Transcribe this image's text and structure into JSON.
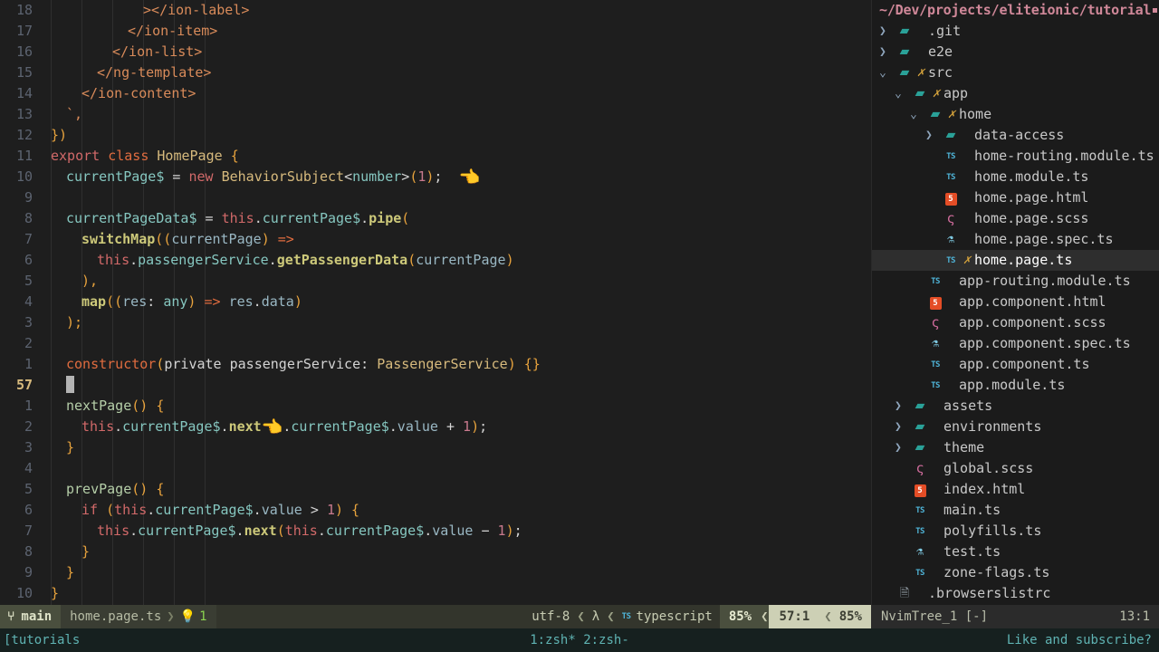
{
  "app": {
    "kind": "neovim-terminal",
    "accent_amber": "#d7ba7d",
    "accent_green": "#8bd450",
    "accent_teal": "#5fb3b3",
    "editor_bg": "#1e1e1e",
    "tree_bg": "#1b1b1b"
  },
  "editor": {
    "lines": [
      {
        "num": "18",
        "current": false,
        "indent": 6,
        "segs": [
          {
            "t": "><",
            "c": "tag"
          },
          {
            "t": "/ion-label>",
            "c": "tag"
          }
        ]
      },
      {
        "num": "17",
        "current": false,
        "indent": 5,
        "segs": [
          {
            "t": "</ion-item>",
            "c": "tag"
          }
        ]
      },
      {
        "num": "16",
        "current": false,
        "indent": 4,
        "segs": [
          {
            "t": "</ion-list>",
            "c": "tag"
          }
        ]
      },
      {
        "num": "15",
        "current": false,
        "indent": 3,
        "segs": [
          {
            "t": "</ng-template>",
            "c": "tag"
          }
        ]
      },
      {
        "num": "14",
        "current": false,
        "indent": 2,
        "segs": [
          {
            "t": "</ion-content>",
            "c": "tag"
          }
        ]
      },
      {
        "num": "13",
        "current": false,
        "indent": 1,
        "segs": [
          {
            "t": "`,",
            "c": "strq"
          }
        ]
      },
      {
        "num": "12",
        "current": false,
        "indent": 0,
        "segs": [
          {
            "t": "})",
            "c": "punct"
          }
        ]
      },
      {
        "num": "11",
        "current": false,
        "indent": 0,
        "segs": [
          {
            "t": "export",
            "c": "kw2"
          },
          {
            "t": " ",
            "c": "plain"
          },
          {
            "t": "class",
            "c": "kw"
          },
          {
            "t": " ",
            "c": "plain"
          },
          {
            "t": "HomePage",
            "c": "type"
          },
          {
            "t": " ",
            "c": "plain"
          },
          {
            "t": "{",
            "c": "punct"
          }
        ]
      },
      {
        "num": "10",
        "current": false,
        "indent": 1,
        "segs": [
          {
            "t": "currentPage$",
            "c": "cyan"
          },
          {
            "t": " ",
            "c": "plain"
          },
          {
            "t": "=",
            "c": "plain"
          },
          {
            "t": " ",
            "c": "plain"
          },
          {
            "t": "new",
            "c": "kw2"
          },
          {
            "t": " ",
            "c": "plain"
          },
          {
            "t": "BehaviorSubject",
            "c": "type"
          },
          {
            "t": "<",
            "c": "plain"
          },
          {
            "t": "number",
            "c": "cyan"
          },
          {
            "t": ">",
            "c": "plain"
          },
          {
            "t": "(",
            "c": "punct"
          },
          {
            "t": "1",
            "c": "num"
          },
          {
            "t": ")",
            "c": "punct"
          },
          {
            "t": ";",
            "c": "plain"
          },
          {
            "t": "  ",
            "c": "plain"
          },
          {
            "t": "👈",
            "c": "emoji"
          }
        ]
      },
      {
        "num": "9",
        "current": false,
        "indent": 1,
        "segs": []
      },
      {
        "num": "8",
        "current": false,
        "indent": 1,
        "segs": [
          {
            "t": "currentPageData$",
            "c": "cyan"
          },
          {
            "t": " = ",
            "c": "plain"
          },
          {
            "t": "this",
            "c": "bobj"
          },
          {
            "t": ".",
            "c": "plain"
          },
          {
            "t": "currentPage$",
            "c": "cyan"
          },
          {
            "t": ".",
            "c": "plain"
          },
          {
            "t": "pipe",
            "c": "fnbold"
          },
          {
            "t": "(",
            "c": "punct"
          }
        ]
      },
      {
        "num": "7",
        "current": false,
        "indent": 2,
        "segs": [
          {
            "t": "switchMap",
            "c": "fnbold"
          },
          {
            "t": "((",
            "c": "punct"
          },
          {
            "t": "currentPage",
            "c": "prop"
          },
          {
            "t": ")",
            "c": "punct"
          },
          {
            "t": " ",
            "c": "plain"
          },
          {
            "t": "=>",
            "c": "op"
          }
        ]
      },
      {
        "num": "6",
        "current": false,
        "indent": 3,
        "segs": [
          {
            "t": "this",
            "c": "bobj"
          },
          {
            "t": ".",
            "c": "plain"
          },
          {
            "t": "passengerService",
            "c": "cyan"
          },
          {
            "t": ".",
            "c": "plain"
          },
          {
            "t": "getPassengerData",
            "c": "fnbold"
          },
          {
            "t": "(",
            "c": "punct"
          },
          {
            "t": "currentPage",
            "c": "prop"
          },
          {
            "t": ")",
            "c": "punct"
          }
        ]
      },
      {
        "num": "5",
        "current": false,
        "indent": 2,
        "segs": [
          {
            "t": "),",
            "c": "punct"
          }
        ]
      },
      {
        "num": "4",
        "current": false,
        "indent": 2,
        "segs": [
          {
            "t": "map",
            "c": "fnbold"
          },
          {
            "t": "((",
            "c": "punct"
          },
          {
            "t": "res",
            "c": "prop"
          },
          {
            "t": ": ",
            "c": "plain"
          },
          {
            "t": "any",
            "c": "cyan"
          },
          {
            "t": ")",
            "c": "punct"
          },
          {
            "t": " ",
            "c": "plain"
          },
          {
            "t": "=>",
            "c": "op"
          },
          {
            "t": " ",
            "c": "plain"
          },
          {
            "t": "res",
            "c": "prop"
          },
          {
            "t": ".",
            "c": "plain"
          },
          {
            "t": "data",
            "c": "prop"
          },
          {
            "t": ")",
            "c": "punct"
          }
        ]
      },
      {
        "num": "3",
        "current": false,
        "indent": 1,
        "segs": [
          {
            "t": ");",
            "c": "punct"
          }
        ]
      },
      {
        "num": "2",
        "current": false,
        "indent": 1,
        "segs": []
      },
      {
        "num": "1",
        "current": false,
        "indent": 1,
        "segs": [
          {
            "t": "constructor",
            "c": "kw"
          },
          {
            "t": "(",
            "c": "punct"
          },
          {
            "t": "private",
            "c": "plain"
          },
          {
            "t": " ",
            "c": "plain"
          },
          {
            "t": "passengerService",
            "c": "plain"
          },
          {
            "t": ": ",
            "c": "plain"
          },
          {
            "t": "PassengerService",
            "c": "type"
          },
          {
            "t": ")",
            "c": "punct"
          },
          {
            "t": " ",
            "c": "plain"
          },
          {
            "t": "{}",
            "c": "punct"
          }
        ]
      },
      {
        "num": "57",
        "current": true,
        "indent": 1,
        "cursor": true,
        "segs": []
      },
      {
        "num": "1",
        "current": false,
        "indent": 1,
        "segs": [
          {
            "t": "nextPage",
            "c": "fn"
          },
          {
            "t": "()",
            "c": "punct"
          },
          {
            "t": " ",
            "c": "plain"
          },
          {
            "t": "{",
            "c": "punct"
          }
        ]
      },
      {
        "num": "2",
        "current": false,
        "indent": 2,
        "segs": [
          {
            "t": "this",
            "c": "bobj"
          },
          {
            "t": ".",
            "c": "plain"
          },
          {
            "t": "currentPage$",
            "c": "cyan"
          },
          {
            "t": ".",
            "c": "plain"
          },
          {
            "t": "next",
            "c": "fnbold"
          },
          {
            "t": "👈",
            "c": "emoji"
          },
          {
            "t": ".",
            "c": "plain"
          },
          {
            "t": "currentPage$",
            "c": "cyan"
          },
          {
            "t": ".",
            "c": "plain"
          },
          {
            "t": "value",
            "c": "prop"
          },
          {
            "t": " + ",
            "c": "plain"
          },
          {
            "t": "1",
            "c": "num"
          },
          {
            "t": ")",
            "c": "punct"
          },
          {
            "t": ";",
            "c": "plain"
          }
        ]
      },
      {
        "num": "3",
        "current": false,
        "indent": 1,
        "segs": [
          {
            "t": "}",
            "c": "punct"
          }
        ]
      },
      {
        "num": "4",
        "current": false,
        "indent": 1,
        "segs": []
      },
      {
        "num": "5",
        "current": false,
        "indent": 1,
        "segs": [
          {
            "t": "prevPage",
            "c": "fn"
          },
          {
            "t": "()",
            "c": "punct"
          },
          {
            "t": " ",
            "c": "plain"
          },
          {
            "t": "{",
            "c": "punct"
          }
        ]
      },
      {
        "num": "6",
        "current": false,
        "indent": 2,
        "segs": [
          {
            "t": "if",
            "c": "kw2"
          },
          {
            "t": " ",
            "c": "plain"
          },
          {
            "t": "(",
            "c": "punct"
          },
          {
            "t": "this",
            "c": "bobj"
          },
          {
            "t": ".",
            "c": "plain"
          },
          {
            "t": "currentPage$",
            "c": "cyan"
          },
          {
            "t": ".",
            "c": "plain"
          },
          {
            "t": "value",
            "c": "prop"
          },
          {
            "t": " > ",
            "c": "plain"
          },
          {
            "t": "1",
            "c": "num"
          },
          {
            "t": ")",
            "c": "punct"
          },
          {
            "t": " ",
            "c": "plain"
          },
          {
            "t": "{",
            "c": "punct"
          }
        ]
      },
      {
        "num": "7",
        "current": false,
        "indent": 3,
        "segs": [
          {
            "t": "this",
            "c": "bobj"
          },
          {
            "t": ".",
            "c": "plain"
          },
          {
            "t": "currentPage$",
            "c": "cyan"
          },
          {
            "t": ".",
            "c": "plain"
          },
          {
            "t": "next",
            "c": "fnbold"
          },
          {
            "t": "(",
            "c": "punct"
          },
          {
            "t": "this",
            "c": "bobj"
          },
          {
            "t": ".",
            "c": "plain"
          },
          {
            "t": "currentPage$",
            "c": "cyan"
          },
          {
            "t": ".",
            "c": "plain"
          },
          {
            "t": "value",
            "c": "prop"
          },
          {
            "t": " − ",
            "c": "plain"
          },
          {
            "t": "1",
            "c": "num"
          },
          {
            "t": ")",
            "c": "punct"
          },
          {
            "t": ";",
            "c": "plain"
          }
        ]
      },
      {
        "num": "8",
        "current": false,
        "indent": 2,
        "segs": [
          {
            "t": "}",
            "c": "punct"
          }
        ]
      },
      {
        "num": "9",
        "current": false,
        "indent": 1,
        "segs": [
          {
            "t": "}",
            "c": "punct"
          }
        ]
      },
      {
        "num": "10",
        "current": false,
        "indent": 0,
        "segs": [
          {
            "t": "}",
            "c": "punct"
          }
        ]
      }
    ]
  },
  "tree": {
    "title": "~/Dev/projects/eliteionic/tutorial",
    "rows": [
      {
        "depth": 0,
        "arrow": "closed",
        "icon": "folder",
        "git": "",
        "label": ".git",
        "selected": false,
        "type": "dir"
      },
      {
        "depth": 0,
        "arrow": "closed",
        "icon": "folder",
        "git": "",
        "label": "e2e",
        "selected": false,
        "type": "dir"
      },
      {
        "depth": 0,
        "arrow": "open",
        "icon": "folder-open",
        "git": "✗",
        "label": "src",
        "selected": false,
        "type": "dir"
      },
      {
        "depth": 1,
        "arrow": "open",
        "icon": "folder-open",
        "git": "✗",
        "label": "app",
        "selected": false,
        "type": "dir"
      },
      {
        "depth": 2,
        "arrow": "open",
        "icon": "folder-open",
        "git": "✗",
        "label": "home",
        "selected": false,
        "type": "dir"
      },
      {
        "depth": 3,
        "arrow": "closed",
        "icon": "folder",
        "git": "",
        "label": "data-access",
        "selected": false,
        "type": "dir"
      },
      {
        "depth": 3,
        "arrow": "none",
        "icon": "ts",
        "git": "",
        "label": "home-routing.module.ts",
        "selected": false,
        "type": "file"
      },
      {
        "depth": 3,
        "arrow": "none",
        "icon": "ts",
        "git": "",
        "label": "home.module.ts",
        "selected": false,
        "type": "file"
      },
      {
        "depth": 3,
        "arrow": "none",
        "icon": "html",
        "git": "",
        "label": "home.page.html",
        "selected": false,
        "type": "file"
      },
      {
        "depth": 3,
        "arrow": "none",
        "icon": "scss",
        "git": "",
        "label": "home.page.scss",
        "selected": false,
        "type": "file"
      },
      {
        "depth": 3,
        "arrow": "none",
        "icon": "spec",
        "git": "",
        "label": "home.page.spec.ts",
        "selected": false,
        "type": "file"
      },
      {
        "depth": 3,
        "arrow": "none",
        "icon": "ts",
        "git": "✗",
        "label": "home.page.ts",
        "selected": true,
        "type": "file"
      },
      {
        "depth": 2,
        "arrow": "none",
        "icon": "ts",
        "git": "",
        "label": "app-routing.module.ts",
        "selected": false,
        "type": "file"
      },
      {
        "depth": 2,
        "arrow": "none",
        "icon": "html",
        "git": "",
        "label": "app.component.html",
        "selected": false,
        "type": "file"
      },
      {
        "depth": 2,
        "arrow": "none",
        "icon": "scss",
        "git": "",
        "label": "app.component.scss",
        "selected": false,
        "type": "file"
      },
      {
        "depth": 2,
        "arrow": "none",
        "icon": "spec",
        "git": "",
        "label": "app.component.spec.ts",
        "selected": false,
        "type": "file"
      },
      {
        "depth": 2,
        "arrow": "none",
        "icon": "ts",
        "git": "",
        "label": "app.component.ts",
        "selected": false,
        "type": "file"
      },
      {
        "depth": 2,
        "arrow": "none",
        "icon": "ts",
        "git": "",
        "label": "app.module.ts",
        "selected": false,
        "type": "file"
      },
      {
        "depth": 1,
        "arrow": "closed",
        "icon": "folder",
        "git": "",
        "label": "assets",
        "selected": false,
        "type": "dir"
      },
      {
        "depth": 1,
        "arrow": "closed",
        "icon": "folder",
        "git": "",
        "label": "environments",
        "selected": false,
        "type": "dir"
      },
      {
        "depth": 1,
        "arrow": "closed",
        "icon": "folder",
        "git": "",
        "label": "theme",
        "selected": false,
        "type": "dir"
      },
      {
        "depth": 1,
        "arrow": "none",
        "icon": "scss",
        "git": "",
        "label": "global.scss",
        "selected": false,
        "type": "file"
      },
      {
        "depth": 1,
        "arrow": "none",
        "icon": "html",
        "git": "",
        "label": "index.html",
        "selected": false,
        "type": "file"
      },
      {
        "depth": 1,
        "arrow": "none",
        "icon": "ts",
        "git": "",
        "label": "main.ts",
        "selected": false,
        "type": "file"
      },
      {
        "depth": 1,
        "arrow": "none",
        "icon": "ts",
        "git": "",
        "label": "polyfills.ts",
        "selected": false,
        "type": "file"
      },
      {
        "depth": 1,
        "arrow": "none",
        "icon": "spec",
        "git": "",
        "label": "test.ts",
        "selected": false,
        "type": "file"
      },
      {
        "depth": 1,
        "arrow": "none",
        "icon": "ts",
        "git": "",
        "label": "zone-flags.ts",
        "selected": false,
        "type": "file"
      },
      {
        "depth": 0,
        "arrow": "none",
        "icon": "txt",
        "git": "",
        "label": ".browserslistrc",
        "selected": false,
        "type": "file"
      }
    ]
  },
  "statusline": {
    "branch_icon": "git-branch-icon",
    "branch": "main",
    "filename": "home.page.ts",
    "diagnostic_icon": "lightbulb-icon",
    "diagnostic_count": "1",
    "encoding": "utf-8",
    "format_icon": "λ",
    "lang_badge": "TS",
    "language": "typescript",
    "percent_left": "85%",
    "position": "57:1",
    "percent_right": "85%"
  },
  "tree_status": {
    "window": "NvimTree_1 [-]",
    "position": "13:1"
  },
  "tmux": {
    "session": "[tutorials",
    "windows": "1:zsh* 2:zsh-",
    "right": "Like and subscribe?"
  }
}
